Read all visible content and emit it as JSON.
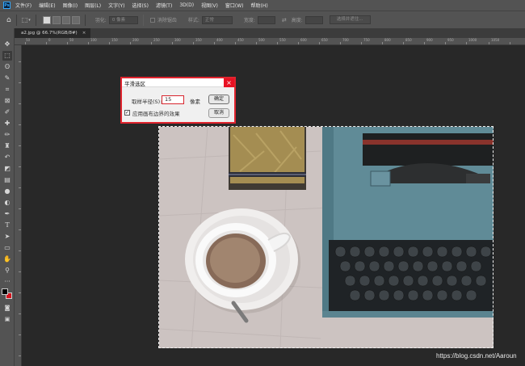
{
  "menubar": {
    "logo": "Ps",
    "items": [
      "文件(F)",
      "编辑(E)",
      "图像(I)",
      "图层(L)",
      "文字(Y)",
      "选择(S)",
      "滤镜(T)",
      "3D(D)",
      "视图(V)",
      "窗口(W)",
      "帮助(H)"
    ]
  },
  "options": {
    "feather_label": "羽化:",
    "feather_value": "0 像素",
    "antialias_label": "消除锯齿",
    "style_label": "样式:",
    "style_value": "正常",
    "width_label": "宽度:",
    "height_label": "高度:",
    "select_mask_label": "选择并遮住..."
  },
  "document_tab": {
    "title": "a2.jpg @ 66.7%(RGB/8#)",
    "close": "×"
  },
  "ruler": {
    "numbers": [
      "50",
      "0",
      "50",
      "100",
      "150",
      "200",
      "250",
      "300",
      "350",
      "400",
      "450",
      "500",
      "550",
      "600",
      "650",
      "700",
      "750",
      "800",
      "850",
      "900",
      "950",
      "1000",
      "1050"
    ]
  },
  "dialog": {
    "title": "平滑选区",
    "close": "×",
    "radius_label": "取样半径(S):",
    "radius_value": "15",
    "radius_unit": "像素",
    "ok_label": "确定",
    "cancel_label": "取消",
    "edge_checkbox": "✓",
    "edge_label": "应用画布边界的效果"
  },
  "watermark": "https://blog.csdn.net/Aaroun",
  "colors": {
    "accent_red": "#e0242e",
    "photoshop_blue": "#31a8ff"
  }
}
